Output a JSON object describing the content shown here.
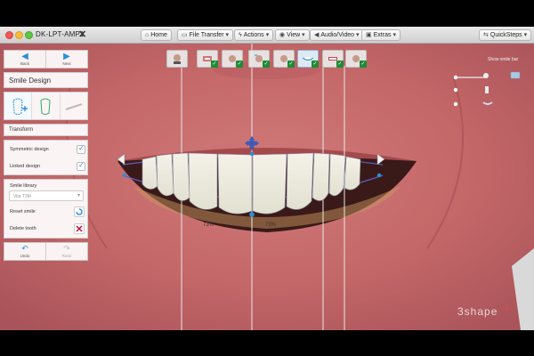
{
  "window": {
    "title": "DK-LPT-AMP1",
    "close": "✕"
  },
  "toolbar": {
    "home_icon": "home-icon",
    "home": "Home",
    "file_icon": "file-icon",
    "file_transfer": "File Transfer",
    "actions_icon": "lightning-icon",
    "actions": "Actions",
    "view_icon": "eye-icon",
    "view": "View",
    "audio_icon": "speaker-icon",
    "audio_video": "Audio/Video",
    "extras": "Extras",
    "quicksteps": "QuickSteps"
  },
  "left_panel": {
    "back": "Back",
    "next": "Next",
    "smile_design": "Smile Design",
    "transform": "Transform",
    "symmetric_design": "Symmetric design",
    "linked_design": "Linked design",
    "smile_library": "Smile library",
    "library_value": "Vita T3M",
    "reset_smile": "Reset smile",
    "delete_tooth": "Delete tooth",
    "undo": "Undo",
    "redo": "Redo"
  },
  "right_panel": {
    "label": "Show smile bar"
  },
  "measurements": {
    "left_percent": "73%",
    "right_percent": "73%"
  },
  "brand": {
    "logo": "3shape"
  },
  "colors": {
    "accent": "#2a8fd6",
    "check_green": "#1e8b35",
    "delete_red": "#c0143c"
  }
}
